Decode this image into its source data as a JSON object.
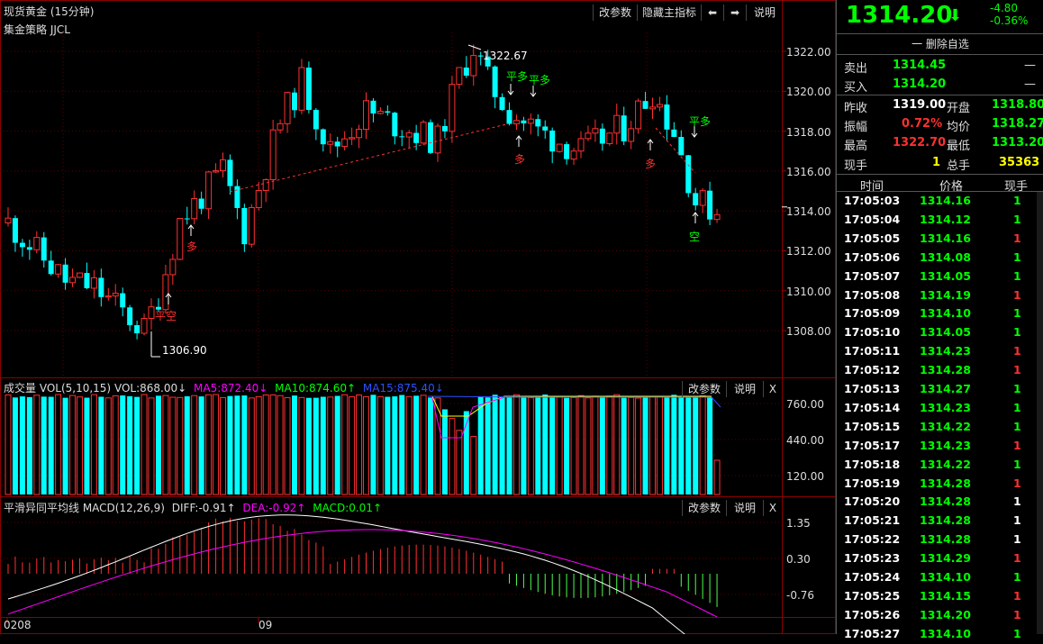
{
  "main": {
    "title": "现货黄金 (15分钟)",
    "strategy": "集金策略 JJCL",
    "buttons": [
      "改参数",
      "隐藏主指标",
      "⬅",
      "➡",
      "说明"
    ],
    "y_ticks": [
      "1322.00",
      "1320.00",
      "1318.00",
      "1316.00",
      "1314.00",
      "1312.00",
      "1310.00",
      "1308.00"
    ],
    "high_label": "1322.67",
    "low_label": "1306.90",
    "signals": [
      {
        "text": "多",
        "color": "#ff3030"
      },
      {
        "text": "平空",
        "color": "#ff3030"
      },
      {
        "text": "平多",
        "color": "#00ff00"
      },
      {
        "text": "平多",
        "color": "#00ff00"
      },
      {
        "text": "多",
        "color": "#ff3030"
      },
      {
        "text": "多",
        "color": "#ff3030"
      },
      {
        "text": "平多",
        "color": "#00ff00"
      },
      {
        "text": "空",
        "color": "#00ff00"
      }
    ]
  },
  "volume": {
    "title": "成交量 VOL(5,10,15)",
    "vol": "VOL:868.00↓",
    "ma5": "MA5:872.40↓",
    "ma10": "MA10:874.60↑",
    "ma15": "MA15:875.40↓",
    "buttons": [
      "改参数",
      "说明",
      "X"
    ],
    "y_ticks": [
      "760.00",
      "440.00",
      "120.00"
    ]
  },
  "macd": {
    "title": "平滑异同平均线 MACD(12,26,9)",
    "diff": "DIFF:-0.91↑",
    "dea": "DEA:-0.92↑",
    "macd": "MACD:0.01↑",
    "buttons": [
      "改参数",
      "说明",
      "X"
    ],
    "y_ticks": [
      "1.35",
      "0.30",
      "-0.76"
    ]
  },
  "x_axis": [
    "0208",
    "09"
  ],
  "quote": {
    "price": "1314.20",
    "arrow": "⬇",
    "change": "-4.80",
    "change_pct": "-0.36%",
    "watch_button": "一 删除自选",
    "sell_label": "卖出",
    "sell_price": "1314.45",
    "sell_vol": "—",
    "buy_label": "买入",
    "buy_price": "1314.20",
    "buy_vol": "—",
    "prev_close_label": "昨收",
    "prev_close": "1319.00",
    "open_label": "开盘",
    "open": "1318.80",
    "amplitude_label": "振幅",
    "amplitude": "0.72%",
    "avg_label": "均价",
    "avg": "1318.27",
    "high_label": "最高",
    "high": "1322.70",
    "low_label": "最低",
    "low": "1313.20",
    "cur_vol_label": "现手",
    "cur_vol": "1",
    "total_vol_label": "总手",
    "total_vol": "35363"
  },
  "ticks": {
    "headers": [
      "时间",
      "价格",
      "现手"
    ],
    "rows": [
      {
        "time": "17:05:03",
        "price": "1314.16",
        "vol": "1",
        "dir": "up"
      },
      {
        "time": "17:05:04",
        "price": "1314.12",
        "vol": "1",
        "dir": "up"
      },
      {
        "time": "17:05:05",
        "price": "1314.16",
        "vol": "1",
        "dir": "down"
      },
      {
        "time": "17:05:06",
        "price": "1314.08",
        "vol": "1",
        "dir": "up"
      },
      {
        "time": "17:05:07",
        "price": "1314.05",
        "vol": "1",
        "dir": "up"
      },
      {
        "time": "17:05:08",
        "price": "1314.19",
        "vol": "1",
        "dir": "down"
      },
      {
        "time": "17:05:09",
        "price": "1314.10",
        "vol": "1",
        "dir": "up"
      },
      {
        "time": "17:05:10",
        "price": "1314.05",
        "vol": "1",
        "dir": "up"
      },
      {
        "time": "17:05:11",
        "price": "1314.23",
        "vol": "1",
        "dir": "down"
      },
      {
        "time": "17:05:12",
        "price": "1314.28",
        "vol": "1",
        "dir": "down"
      },
      {
        "time": "17:05:13",
        "price": "1314.27",
        "vol": "1",
        "dir": "up"
      },
      {
        "time": "17:05:14",
        "price": "1314.23",
        "vol": "1",
        "dir": "up"
      },
      {
        "time": "17:05:15",
        "price": "1314.22",
        "vol": "1",
        "dir": "up"
      },
      {
        "time": "17:05:17",
        "price": "1314.23",
        "vol": "1",
        "dir": "down"
      },
      {
        "time": "17:05:18",
        "price": "1314.22",
        "vol": "1",
        "dir": "up"
      },
      {
        "time": "17:05:19",
        "price": "1314.28",
        "vol": "1",
        "dir": "down"
      },
      {
        "time": "17:05:20",
        "price": "1314.28",
        "vol": "1",
        "dir": "flat"
      },
      {
        "time": "17:05:21",
        "price": "1314.28",
        "vol": "1",
        "dir": "flat"
      },
      {
        "time": "17:05:22",
        "price": "1314.28",
        "vol": "1",
        "dir": "flat"
      },
      {
        "time": "17:05:23",
        "price": "1314.29",
        "vol": "1",
        "dir": "down"
      },
      {
        "time": "17:05:24",
        "price": "1314.10",
        "vol": "1",
        "dir": "up"
      },
      {
        "time": "17:05:25",
        "price": "1314.15",
        "vol": "1",
        "dir": "down"
      },
      {
        "time": "17:05:26",
        "price": "1314.20",
        "vol": "1",
        "dir": "down"
      },
      {
        "time": "17:05:27",
        "price": "1314.10",
        "vol": "1",
        "dir": "up"
      }
    ]
  },
  "colors": {
    "bull": "#ff3030",
    "bear": "#00ffff",
    "up_text": "#ff3030",
    "down_text": "#00ff00",
    "price_green": "#00ff00",
    "yellow": "#ffff00",
    "magenta": "#ff00ff",
    "grid": "#8b0000"
  }
}
